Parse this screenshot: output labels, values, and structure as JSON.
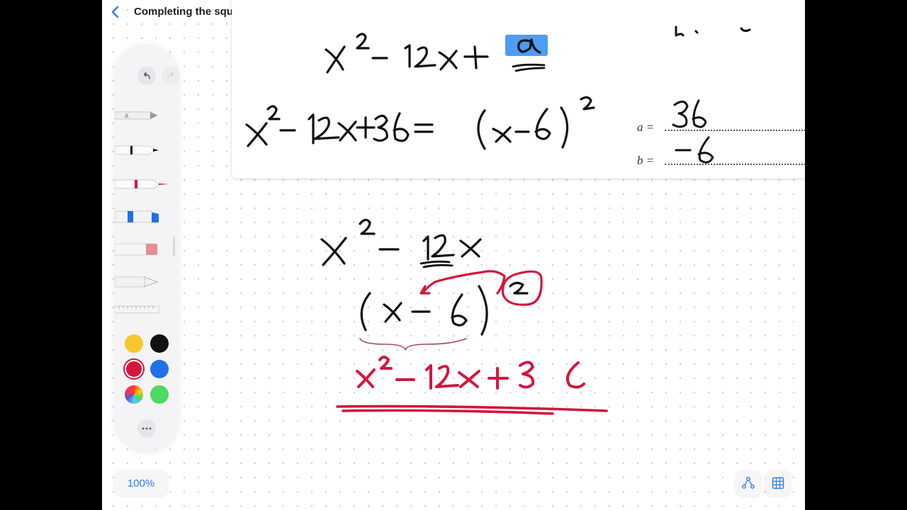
{
  "header": {
    "title": "Completing the square",
    "back_icon": "chevron-left-icon",
    "title_menu_icon": "chevron-down-icon",
    "tools": [
      "pencil-tip-icon",
      "notes-icon",
      "shapes-icon",
      "textbox-icon",
      "image-icon"
    ],
    "actions": [
      "undo-icon",
      "share-icon",
      "new-page-icon"
    ]
  },
  "worksheet": {
    "label_a": "a =",
    "label_b": "b ="
  },
  "palette": {
    "tools": [
      "pen-tool",
      "fineliner-tool",
      "red-pen-tool",
      "highlighter-tool",
      "eraser-tool",
      "lasso-tool",
      "ruler-tool"
    ],
    "colors": [
      "#f7c72c",
      "#111111",
      "#d4163c",
      "#1f6fe8",
      "color-wheel",
      "#4cd964"
    ],
    "selected_color": "#d4163c"
  },
  "footer": {
    "zoom": "100%",
    "lasso_icon": "lasso-nodes-icon",
    "grid_icon": "grid-icon"
  },
  "colors": {
    "accent": "#2f7cf6",
    "ink_black": "#111111",
    "ink_red": "#d4163c",
    "highlight_blue": "#2c8cf4"
  }
}
